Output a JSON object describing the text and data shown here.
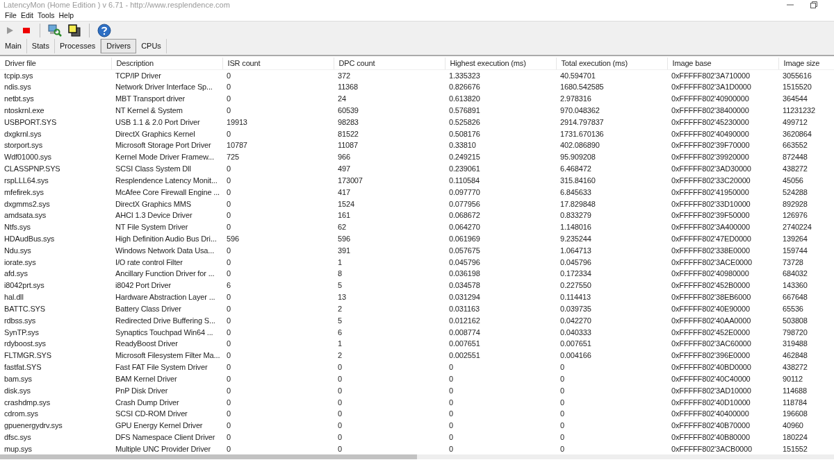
{
  "window": {
    "title": "LatencyMon  (Home Edition )  v 6.71 - http://www.resplendence.com"
  },
  "menu": [
    "File",
    "Edit",
    "Tools",
    "Help"
  ],
  "tabs": [
    {
      "label": "Main",
      "selected": false
    },
    {
      "label": "Stats",
      "selected": false
    },
    {
      "label": "Processes",
      "selected": false
    },
    {
      "label": "Drivers",
      "selected": true
    },
    {
      "label": "CPUs",
      "selected": false
    }
  ],
  "table": {
    "columns": [
      "Driver file",
      "Description",
      "ISR count",
      "DPC count",
      "Highest execution (ms)",
      "Total execution (ms)",
      "Image base",
      "Image size"
    ],
    "rows": [
      [
        "tcpip.sys",
        "TCP/IP Driver",
        "0",
        "372",
        "1.335323",
        "40.594701",
        "0xFFFFF802'3A710000",
        "3055616"
      ],
      [
        "ndis.sys",
        "Network Driver Interface Sp...",
        "0",
        "11368",
        "0.826676",
        "1680.542585",
        "0xFFFFF802'3A1D0000",
        "1515520"
      ],
      [
        "netbt.sys",
        "MBT Transport driver",
        "0",
        "24",
        "0.613820",
        "2.978316",
        "0xFFFFF802'40900000",
        "364544"
      ],
      [
        "ntoskrnl.exe",
        "NT Kernel & System",
        "0",
        "60539",
        "0.576891",
        "970.048362",
        "0xFFFFF802'38400000",
        "11231232"
      ],
      [
        "USBPORT.SYS",
        "USB 1.1 & 2.0 Port Driver",
        "19913",
        "98283",
        "0.525826",
        "2914.797837",
        "0xFFFFF802'45230000",
        "499712"
      ],
      [
        "dxgkrnl.sys",
        "DirectX Graphics Kernel",
        "0",
        "81522",
        "0.508176",
        "1731.670136",
        "0xFFFFF802'40490000",
        "3620864"
      ],
      [
        "storport.sys",
        "Microsoft Storage Port Driver",
        "10787",
        "11087",
        "0.33810",
        "402.086890",
        "0xFFFFF802'39F70000",
        "663552"
      ],
      [
        "Wdf01000.sys",
        "Kernel Mode Driver Framew...",
        "725",
        "966",
        "0.249215",
        "95.909208",
        "0xFFFFF802'39920000",
        "872448"
      ],
      [
        "CLASSPNP.SYS",
        "SCSI Class System Dll",
        "0",
        "497",
        "0.239061",
        "6.468472",
        "0xFFFFF802'3AD30000",
        "438272"
      ],
      [
        "rspLLL64.sys",
        "Resplendence Latency Monit...",
        "0",
        "173007",
        "0.110584",
        "315.84160",
        "0xFFFFF802'33C20000",
        "45056"
      ],
      [
        "mfefirek.sys",
        "McAfee Core Firewall Engine ...",
        "0",
        "417",
        "0.097770",
        "6.845633",
        "0xFFFFF802'41950000",
        "524288"
      ],
      [
        "dxgmms2.sys",
        "DirectX Graphics MMS",
        "0",
        "1524",
        "0.077956",
        "17.829848",
        "0xFFFFF802'33D10000",
        "892928"
      ],
      [
        "amdsata.sys",
        "AHCI 1.3 Device Driver",
        "0",
        "161",
        "0.068672",
        "0.833279",
        "0xFFFFF802'39F50000",
        "126976"
      ],
      [
        "Ntfs.sys",
        "NT File System Driver",
        "0",
        "62",
        "0.064270",
        "1.148016",
        "0xFFFFF802'3A400000",
        "2740224"
      ],
      [
        "HDAudBus.sys",
        "High Definition Audio Bus Dri...",
        "596",
        "596",
        "0.061969",
        "9.235244",
        "0xFFFFF802'47ED0000",
        "139264"
      ],
      [
        "Ndu.sys",
        "Windows Network Data Usa...",
        "0",
        "391",
        "0.057675",
        "1.064713",
        "0xFFFFF802'338E0000",
        "159744"
      ],
      [
        "iorate.sys",
        "I/O rate control Filter",
        "0",
        "1",
        "0.045796",
        "0.045796",
        "0xFFFFF802'3ACE0000",
        "73728"
      ],
      [
        "afd.sys",
        "Ancillary Function Driver for ...",
        "0",
        "8",
        "0.036198",
        "0.172334",
        "0xFFFFF802'40980000",
        "684032"
      ],
      [
        "i8042prt.sys",
        "i8042 Port Driver",
        "6",
        "5",
        "0.034578",
        "0.227550",
        "0xFFFFF802'452B0000",
        "143360"
      ],
      [
        "hal.dll",
        "Hardware Abstraction Layer ...",
        "0",
        "13",
        "0.031294",
        "0.114413",
        "0xFFFFF802'38EB6000",
        "667648"
      ],
      [
        "BATTC.SYS",
        "Battery Class Driver",
        "0",
        "2",
        "0.031163",
        "0.039735",
        "0xFFFFF802'40E90000",
        "65536"
      ],
      [
        "rdbss.sys",
        "Redirected Drive Buffering S...",
        "0",
        "5",
        "0.012162",
        "0.042270",
        "0xFFFFF802'40AA0000",
        "503808"
      ],
      [
        "SynTP.sys",
        "Synaptics Touchpad Win64 ...",
        "0",
        "6",
        "0.008774",
        "0.040333",
        "0xFFFFF802'452E0000",
        "798720"
      ],
      [
        "rdyboost.sys",
        "ReadyBoost Driver",
        "0",
        "1",
        "0.007651",
        "0.007651",
        "0xFFFFF802'3AC60000",
        "319488"
      ],
      [
        "FLTMGR.SYS",
        "Microsoft Filesystem Filter Ma...",
        "0",
        "2",
        "0.002551",
        "0.004166",
        "0xFFFFF802'396E0000",
        "462848"
      ],
      [
        "fastfat.SYS",
        "Fast FAT File System Driver",
        "0",
        "0",
        "0",
        "0",
        "0xFFFFF802'40BD0000",
        "438272"
      ],
      [
        "bam.sys",
        "BAM Kernel Driver",
        "0",
        "0",
        "0",
        "0",
        "0xFFFFF802'40C40000",
        "90112"
      ],
      [
        "disk.sys",
        "PnP Disk Driver",
        "0",
        "0",
        "0",
        "0",
        "0xFFFFF802'3AD10000",
        "114688"
      ],
      [
        "crashdmp.sys",
        "Crash Dump Driver",
        "0",
        "0",
        "0",
        "0",
        "0xFFFFF802'40D10000",
        "118784"
      ],
      [
        "cdrom.sys",
        "SCSI CD-ROM Driver",
        "0",
        "0",
        "0",
        "0",
        "0xFFFFF802'40400000",
        "196608"
      ],
      [
        "gpuenergydrv.sys",
        "GPU Energy Kernel Driver",
        "0",
        "0",
        "0",
        "0",
        "0xFFFFF802'40B70000",
        "40960"
      ],
      [
        "dfsc.sys",
        "DFS Namespace Client Driver",
        "0",
        "0",
        "0",
        "0",
        "0xFFFFF802'40B80000",
        "180224"
      ],
      [
        "mup.sys",
        "Multiple UNC Provider Driver",
        "0",
        "0",
        "0",
        "0",
        "0xFFFFF802'3ACB0000",
        "151552"
      ]
    ]
  }
}
